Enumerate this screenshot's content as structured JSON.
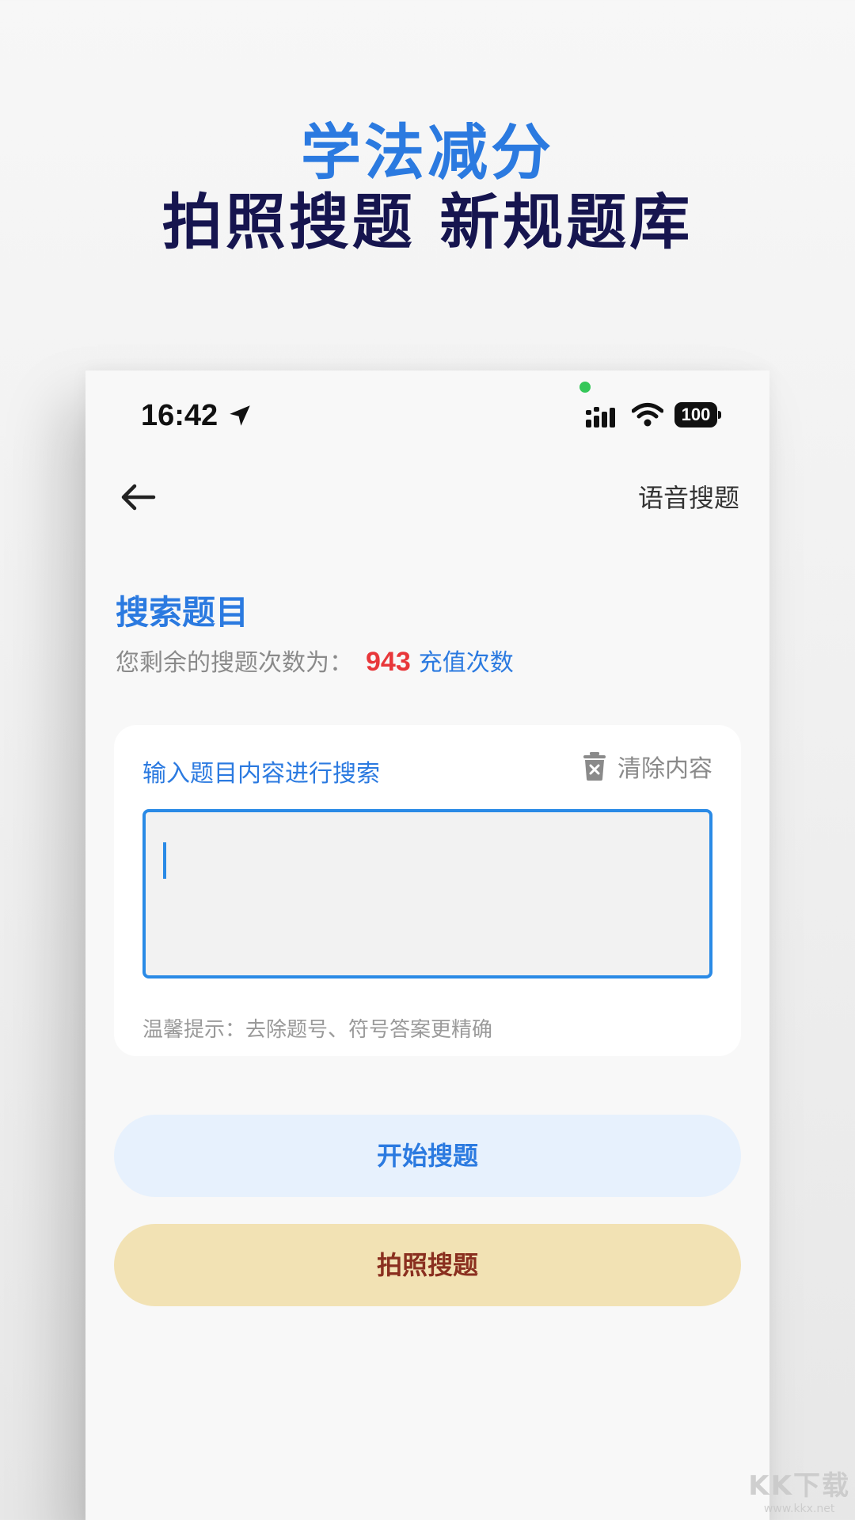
{
  "promo": {
    "line1": "学法减分",
    "line2": "拍照搜题 新规题库"
  },
  "status_bar": {
    "time": "16:42",
    "battery": "100"
  },
  "header": {
    "voice_search_label": "语音搜题"
  },
  "main": {
    "title": "搜索题目",
    "remaining_label": "您剩余的搜题次数为：",
    "remaining_count": "943",
    "recharge_label": "充值次数"
  },
  "search_card": {
    "input_hint": "输入题目内容进行搜索",
    "clear_label": "清除内容",
    "input_value": "",
    "tip": "温馨提示：去除题号、符号答案更精确"
  },
  "actions": {
    "start_label": "开始搜题",
    "photo_label": "拍照搜题"
  },
  "watermark": {
    "logo": "KK下载",
    "url": "www.kkx.net"
  },
  "colors": {
    "accent_blue": "#2b7ae0",
    "count_red": "#e8373a",
    "photo_button_bg": "#f2e2b4",
    "photo_button_text": "#8a2f1f",
    "start_button_bg": "#e7f1fd",
    "promo_dark": "#16154f"
  }
}
